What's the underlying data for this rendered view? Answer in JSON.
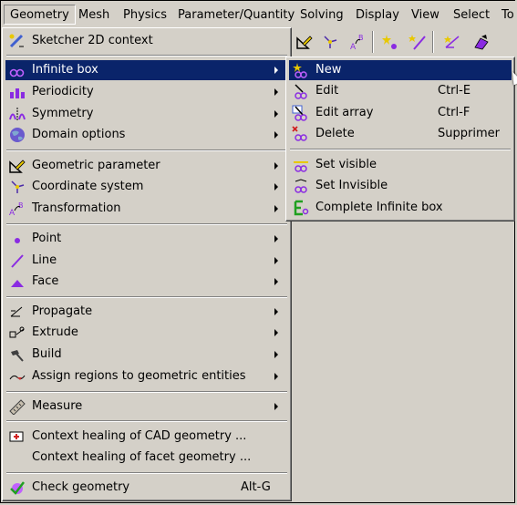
{
  "menubar": {
    "items": [
      {
        "label": "Geometry",
        "active": true
      },
      {
        "label": "Mesh"
      },
      {
        "label": "Physics"
      },
      {
        "label": "Parameter/Quantity"
      },
      {
        "label": "Solving"
      },
      {
        "label": "Display"
      },
      {
        "label": "View"
      },
      {
        "label": "Select"
      },
      {
        "label": "To"
      }
    ]
  },
  "toolbar": {
    "icons": [
      "geometric-parameter-icon",
      "coordinate-system-icon",
      "transformation-icon",
      "new-point-icon",
      "new-line-icon",
      "propagate-icon",
      "build-icon"
    ]
  },
  "geometry_menu": {
    "items": [
      {
        "label": "Sketcher 2D context",
        "icon": "sketcher-icon"
      },
      {
        "label": "Infinite box",
        "icon": "infinite-box-icon",
        "submenu": true,
        "selected": true
      },
      {
        "label": "Periodicity",
        "icon": "periodicity-icon",
        "submenu": true
      },
      {
        "label": "Symmetry",
        "icon": "symmetry-icon",
        "submenu": true
      },
      {
        "label": "Domain options",
        "icon": "globe-icon",
        "submenu": true
      },
      {
        "label": "Geometric parameter",
        "icon": "geometric-parameter-icon",
        "submenu": true
      },
      {
        "label": "Coordinate system",
        "icon": "coordinate-system-icon",
        "submenu": true
      },
      {
        "label": "Transformation",
        "icon": "transformation-icon",
        "submenu": true
      },
      {
        "label": "Point",
        "icon": "point-icon",
        "submenu": true
      },
      {
        "label": "Line",
        "icon": "line-icon",
        "submenu": true
      },
      {
        "label": "Face",
        "icon": "face-icon",
        "submenu": true
      },
      {
        "label": "Propagate",
        "icon": "propagate-icon",
        "submenu": true
      },
      {
        "label": "Extrude",
        "icon": "extrude-icon",
        "submenu": true
      },
      {
        "label": "Build",
        "icon": "build-icon",
        "submenu": true
      },
      {
        "label": "Assign regions to geometric entities",
        "icon": "assign-regions-icon",
        "submenu": true
      },
      {
        "label": "Measure",
        "icon": "measure-icon",
        "submenu": true
      },
      {
        "label": "Context healing of CAD geometry ...",
        "icon": "healing-icon"
      },
      {
        "label": "Context healing of facet geometry ..."
      },
      {
        "label": "Check geometry",
        "icon": "check-geometry-icon",
        "shortcut": "Alt-G"
      }
    ]
  },
  "infinite_box_menu": {
    "items": [
      {
        "label": "New",
        "icon": "new-icon",
        "selected": true
      },
      {
        "label": "Edit",
        "icon": "edit-icon",
        "shortcut": "Ctrl-E"
      },
      {
        "label": "Edit array",
        "icon": "edit-array-icon",
        "shortcut": "Ctrl-F"
      },
      {
        "label": "Delete",
        "icon": "delete-icon",
        "shortcut": "Supprimer"
      },
      {
        "label": "Set visible",
        "icon": "set-visible-icon"
      },
      {
        "label": "Set Invisible",
        "icon": "set-invisible-icon"
      },
      {
        "label": "Complete Infinite box",
        "icon": "complete-infinite-box-icon"
      }
    ]
  },
  "colors": {
    "menu_bg": "#d4d0c8",
    "selection": "#0a246a",
    "icon_purple": "#8a2be2",
    "icon_yellow": "#e8c800"
  }
}
